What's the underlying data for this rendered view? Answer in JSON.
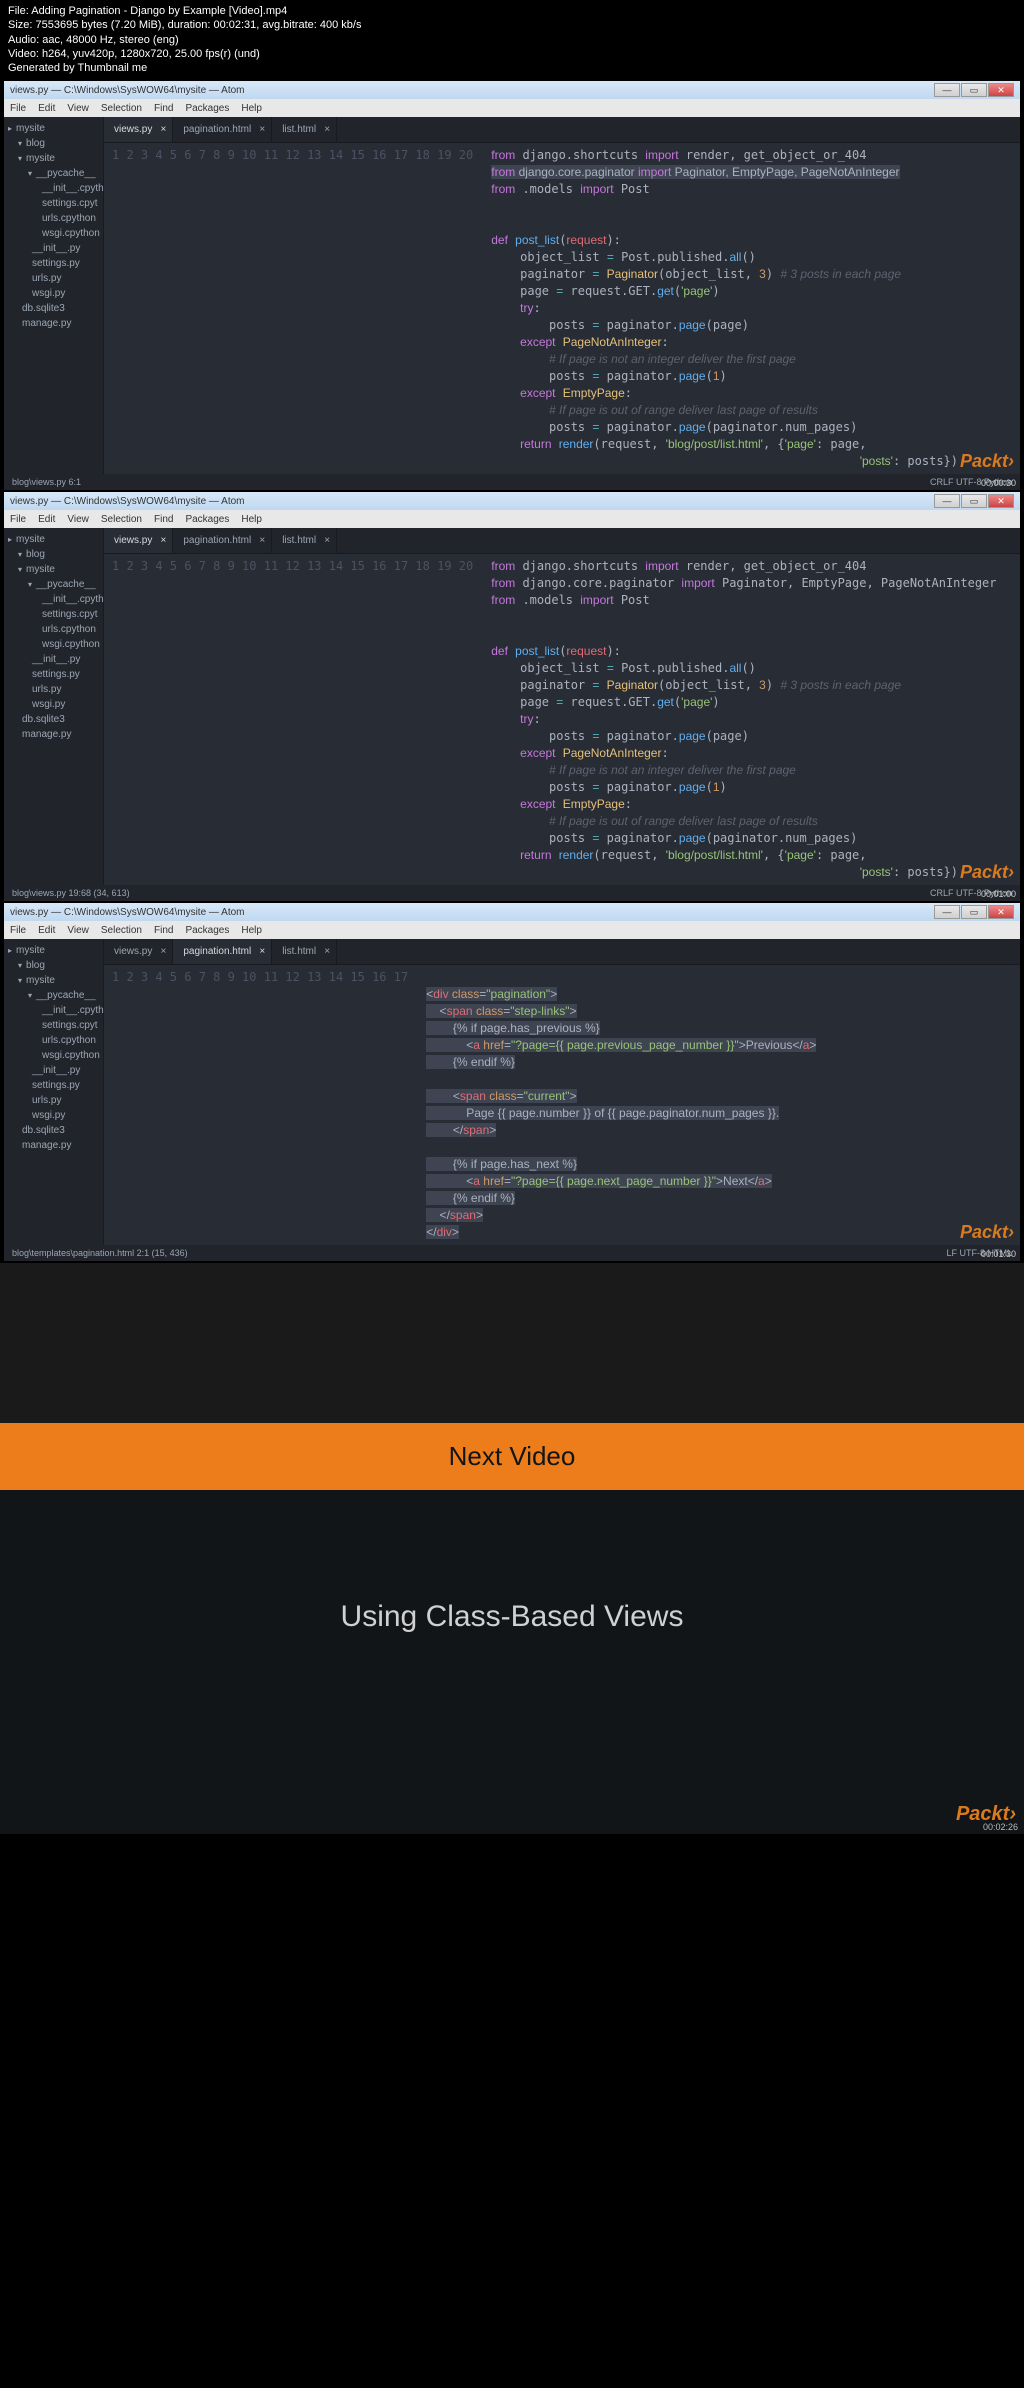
{
  "meta": {
    "file": "File: Adding Pagination - Django by Example [Video].mp4",
    "size": "Size: 7553695 bytes (7.20 MiB), duration: 00:02:31, avg.bitrate: 400 kb/s",
    "audio": "Audio: aac, 48000 Hz, stereo (eng)",
    "video": "Video: h264, yuv420p, 1280x720, 25.00 fps(r) (und)",
    "gen": "Generated by Thumbnail me"
  },
  "titlebar": "views.py — C:\\Windows\\SysWOW64\\mysite — Atom",
  "menuitems": [
    "File",
    "Edit",
    "View",
    "Selection",
    "Find",
    "Packages",
    "Help"
  ],
  "tree": [
    {
      "label": "mysite",
      "indent": 0,
      "icon": "▸",
      "folder": true
    },
    {
      "label": "blog",
      "indent": 1,
      "icon": "▾",
      "folder": true
    },
    {
      "label": "mysite",
      "indent": 1,
      "icon": "▾",
      "folder": true
    },
    {
      "label": "__pycache__",
      "indent": 2,
      "icon": "▾",
      "folder": true
    },
    {
      "label": "__init__.cpyth",
      "indent": 3,
      "icon": "",
      "file": true
    },
    {
      "label": "settings.cpyt",
      "indent": 3,
      "icon": "",
      "file": true
    },
    {
      "label": "urls.cpython",
      "indent": 3,
      "icon": "",
      "file": true
    },
    {
      "label": "wsgi.cpython",
      "indent": 3,
      "icon": "",
      "file": true
    },
    {
      "label": "__init__.py",
      "indent": 2,
      "icon": "",
      "file": true
    },
    {
      "label": "settings.py",
      "indent": 2,
      "icon": "",
      "file": true
    },
    {
      "label": "urls.py",
      "indent": 2,
      "icon": "",
      "file": true
    },
    {
      "label": "wsgi.py",
      "indent": 2,
      "icon": "",
      "file": true
    },
    {
      "label": "db.sqlite3",
      "indent": 1,
      "icon": "",
      "file": true
    },
    {
      "label": "manage.py",
      "indent": 1,
      "icon": "",
      "file": true
    }
  ],
  "tabs1": [
    {
      "label": "views.py",
      "active": true
    },
    {
      "label": "pagination.html",
      "active": false
    },
    {
      "label": "list.html",
      "active": false
    }
  ],
  "tabs3": [
    {
      "label": "views.py",
      "active": false
    },
    {
      "label": "pagination.html",
      "active": true
    },
    {
      "label": "list.html",
      "active": false
    }
  ],
  "status1": {
    "left": "blog\\views.py  6:1",
    "right": "CRLF  UTF-8  Python"
  },
  "status2": {
    "left": "blog\\views.py  19:68  (34, 613)",
    "right": "CRLF  UTF-8  Python"
  },
  "status3": {
    "left": "blog\\templates\\pagination.html  2:1  (15, 436)",
    "right": "LF  UTF-8  HTML"
  },
  "watermark": "Packt›",
  "ts1": "00:00:30",
  "ts2": "00:01:00",
  "ts3": "00:01:30",
  "ts4": "00:02:26",
  "nextvideo": "Next Video",
  "titleslide": "Using Class-Based Views"
}
